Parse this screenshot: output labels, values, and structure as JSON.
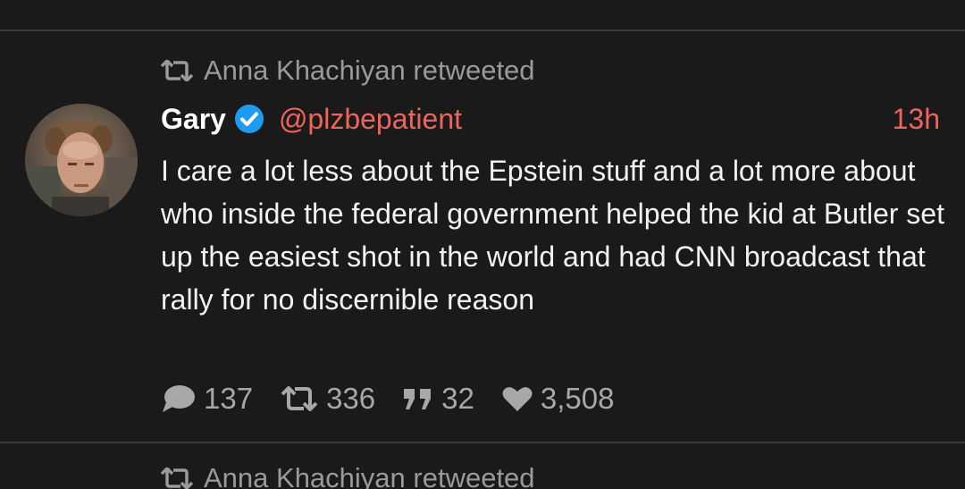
{
  "feed": {
    "tweet": {
      "retweeted_by": "Anna Khachiyan retweeted",
      "display_name": "Gary",
      "handle": "@plzbepatient",
      "time": "13h",
      "text": "I care a lot less about the Epstein stuff and a lot more about who inside the federal government helped the kid at Butler set up the easiest shot in the world and had CNN broadcast that rally for no discernible reason",
      "actions": {
        "replies": "137",
        "retweets": "336",
        "quotes": "32",
        "likes": "3,508"
      }
    },
    "next_tweet": {
      "retweeted_by": "Anna Khachiyan retweeted"
    }
  },
  "colors": {
    "background": "#1a1a1a",
    "accent": "#f0645a",
    "verified": "#1d9bf0",
    "muted": "#9a9a9a"
  }
}
